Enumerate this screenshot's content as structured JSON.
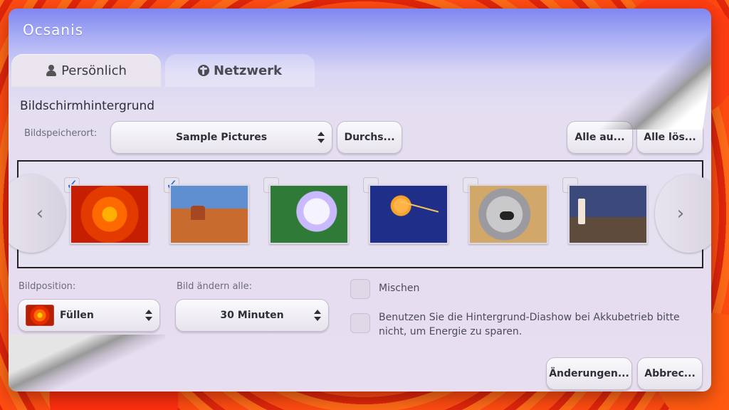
{
  "window": {
    "title": "Ocsanis"
  },
  "tabs": {
    "personal": "Persönlich",
    "network": "Netzwerk"
  },
  "section": {
    "title": "Bildschirmhintergrund"
  },
  "location": {
    "label": "Bildspeicherort:",
    "value": "Sample Pictures",
    "browse_button": "Durchs...",
    "select_all_button": "Alle au...",
    "clear_all_button": "Alle lös..."
  },
  "gallery": {
    "thumbnails": [
      {
        "checked": true
      },
      {
        "checked": true
      },
      {
        "checked": false
      },
      {
        "checked": false
      },
      {
        "checked": false
      },
      {
        "checked": false
      }
    ]
  },
  "picture_position": {
    "label": "Bildposition:",
    "value": "Füllen"
  },
  "change_interval": {
    "label": "Bild ändern alle:",
    "value": "30 Minuten"
  },
  "options": {
    "shuffle_label": "Mischen",
    "battery_text": "Benutzen Sie die Hintergrund-Diashow bei Akkubetrieb bitte nicht, um Energie zu sparen."
  },
  "buttons": {
    "save": "Änderungen...",
    "cancel": "Abbrec..."
  }
}
